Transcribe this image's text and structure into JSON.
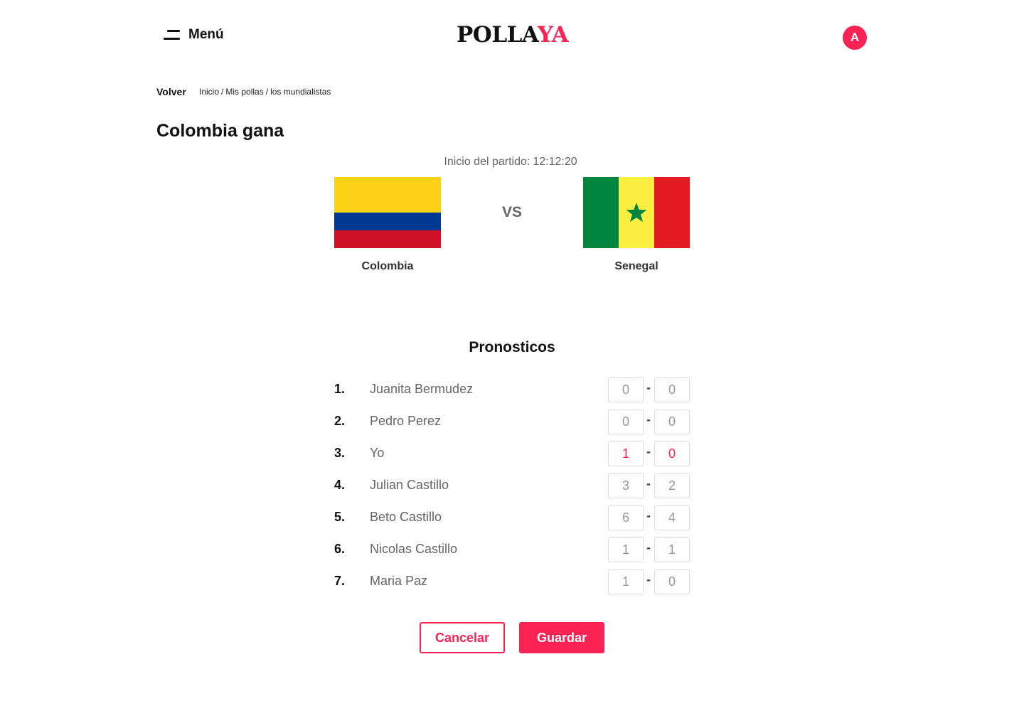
{
  "header": {
    "menu_label": "Menú",
    "logo_part1": "POLLA",
    "logo_part2": "YA",
    "avatar_initial": "A"
  },
  "nav": {
    "back_label": "Volver",
    "breadcrumb": [
      "Inicio",
      "/",
      "Mis pollas",
      "/",
      "los mundialistas"
    ]
  },
  "page_title": "Colombia gana",
  "match": {
    "start_label": "Inicio del partido:",
    "start_time": "12:12:20",
    "vs_label": "VS",
    "home_team": "Colombia",
    "away_team": "Senegal"
  },
  "predictions": {
    "title": "Pronosticos",
    "rows": [
      {
        "rank": "1.",
        "name": "Juanita Bermudez",
        "home": "0",
        "away": "0"
      },
      {
        "rank": "2.",
        "name": "Pedro Perez",
        "home": "0",
        "away": "0"
      },
      {
        "rank": "3.",
        "name": "Yo",
        "home": "1",
        "away": "0",
        "mine": true
      },
      {
        "rank": "4.",
        "name": "Julian Castillo",
        "home": "3",
        "away": "2"
      },
      {
        "rank": "5.",
        "name": "Beto Castillo",
        "home": "6",
        "away": "4"
      },
      {
        "rank": "6.",
        "name": "Nicolas Castillo",
        "home": "1",
        "away": "1"
      },
      {
        "rank": "7.",
        "name": "Maria Paz",
        "home": "1",
        "away": "0"
      }
    ],
    "separator": "-"
  },
  "actions": {
    "cancel_label": "Cancelar",
    "save_label": "Guardar"
  },
  "colors": {
    "accent": "#fb2353",
    "text": "#111111",
    "muted": "#666666"
  }
}
